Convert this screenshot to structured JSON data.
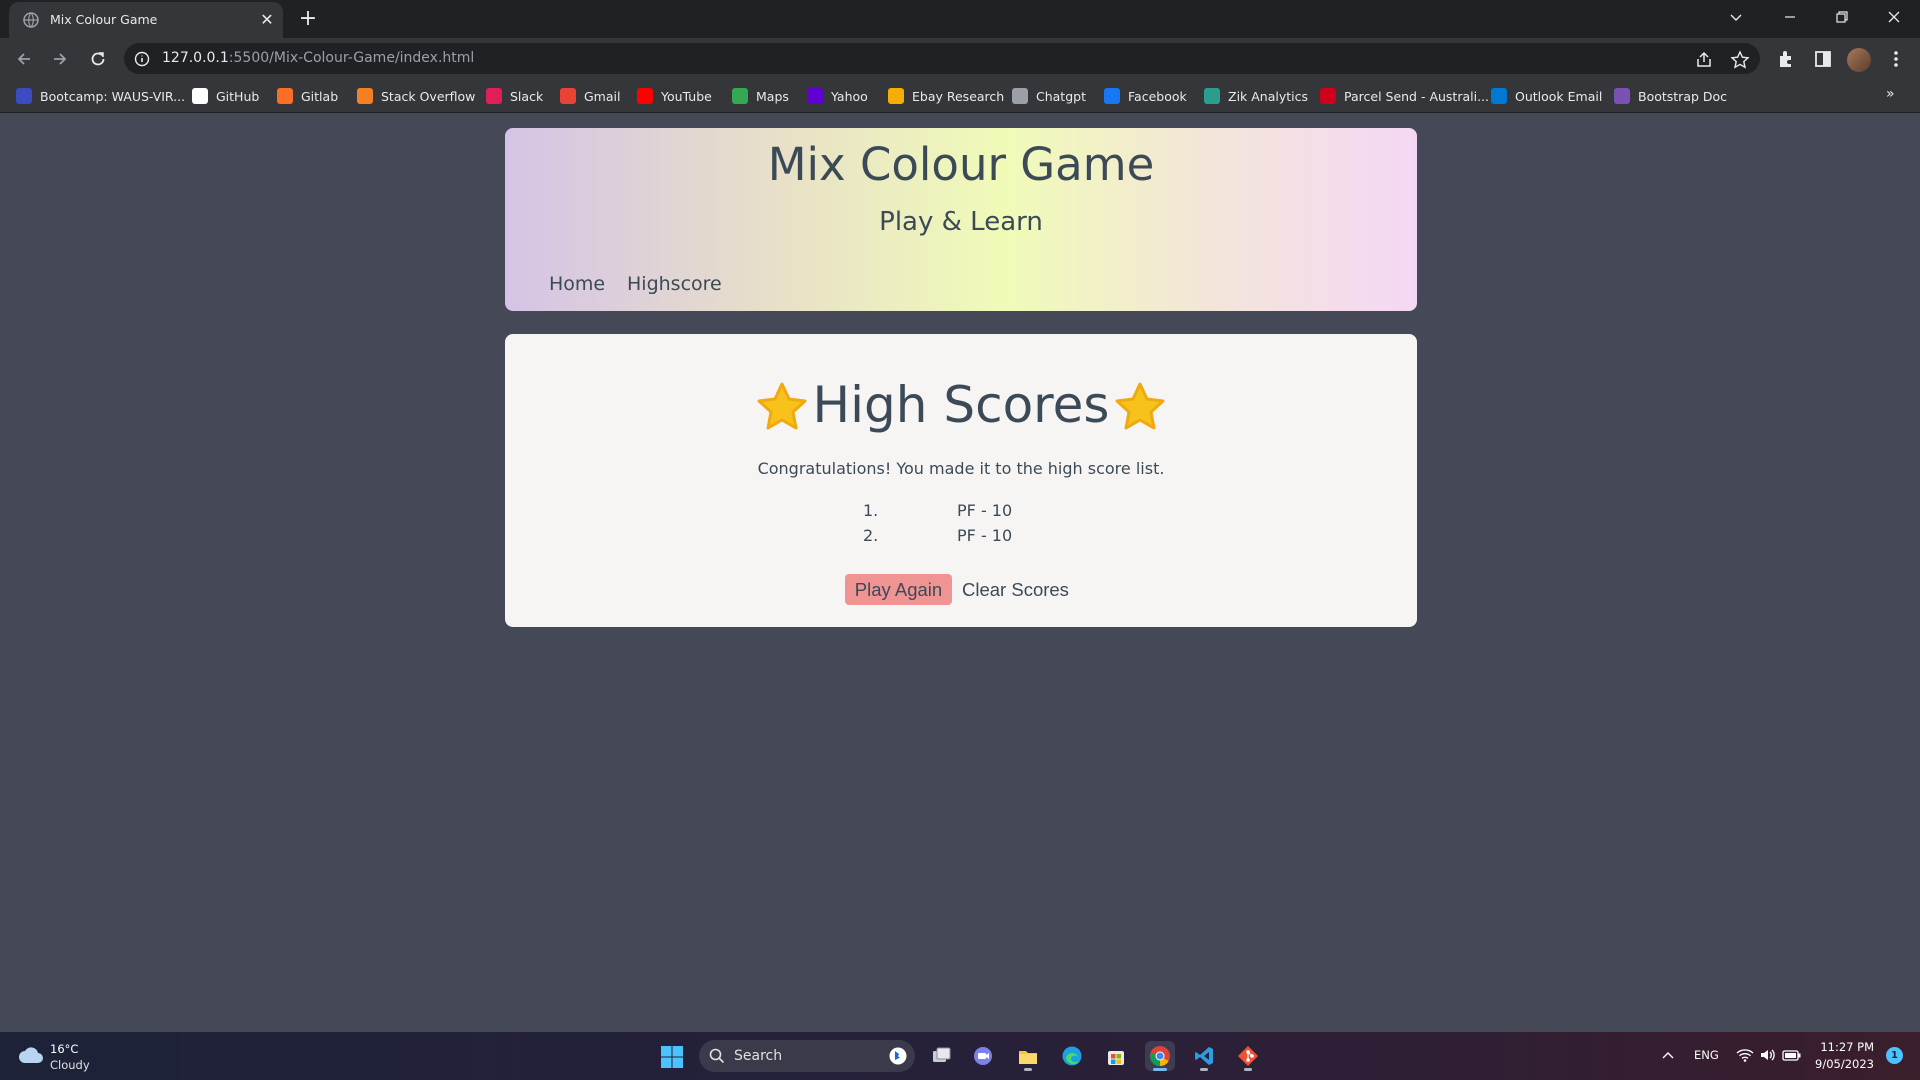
{
  "browser": {
    "tab_title": "Mix Colour Game",
    "url_host": "127.0.0.1",
    "url_rest": ":5500/Mix-Colour-Game/index.html"
  },
  "bookmarks": [
    {
      "label": "Bootcamp: WAUS-VIR...",
      "icon": "bootcamp-icon",
      "color": "#3b4cc0"
    },
    {
      "label": "GitHub",
      "icon": "github-icon",
      "color": "#ffffff"
    },
    {
      "label": "Gitlab",
      "icon": "gitlab-icon",
      "color": "#fc6d26"
    },
    {
      "label": "Stack Overflow",
      "icon": "stackoverflow-icon",
      "color": "#f48024"
    },
    {
      "label": "Slack",
      "icon": "slack-icon",
      "color": "#e01e5a"
    },
    {
      "label": "Gmail",
      "icon": "gmail-icon",
      "color": "#ea4335"
    },
    {
      "label": "YouTube",
      "icon": "youtube-icon",
      "color": "#ff0000"
    },
    {
      "label": "Maps",
      "icon": "maps-icon",
      "color": "#34a853"
    },
    {
      "label": "Yahoo",
      "icon": "yahoo-icon",
      "color": "#6001d2"
    },
    {
      "label": "Ebay Research",
      "icon": "ebay-icon",
      "color": "#f5af02"
    },
    {
      "label": "Chatgpt",
      "icon": "chatgpt-icon",
      "color": "#9aa0a6"
    },
    {
      "label": "Facebook",
      "icon": "facebook-icon",
      "color": "#1877f2"
    },
    {
      "label": "Zik Analytics",
      "icon": "zik-icon",
      "color": "#2a9d8f"
    },
    {
      "label": "Parcel Send - Australi...",
      "icon": "parcelsend-icon",
      "color": "#d0021b"
    },
    {
      "label": "Outlook Email",
      "icon": "outlook-icon",
      "color": "#0078d4"
    },
    {
      "label": "Bootstrap Doc",
      "icon": "bootstrap-icon",
      "color": "#7952b3"
    }
  ],
  "header": {
    "title": "Mix Colour Game",
    "subtitle": "Play & Learn",
    "nav": [
      "Home",
      "Highscore"
    ]
  },
  "highscores": {
    "title": "High Scores",
    "message": "Congratulations! You made it to the high score list.",
    "entries": [
      {
        "rank": "1.",
        "entry": "PF - 10"
      },
      {
        "rank": "2.",
        "entry": "PF - 10"
      }
    ],
    "play_again_label": "Play Again",
    "clear_scores_label": "Clear Scores"
  },
  "taskbar": {
    "weather_temp": "16°C",
    "weather_condition": "Cloudy",
    "search_placeholder": "Search",
    "language": "ENG",
    "time": "11:27 PM",
    "date": "9/05/2023",
    "notification_count": "1"
  },
  "colors": {
    "page_background": "#454857",
    "play_again_button": "#f09393",
    "text": "#3c4a57"
  }
}
